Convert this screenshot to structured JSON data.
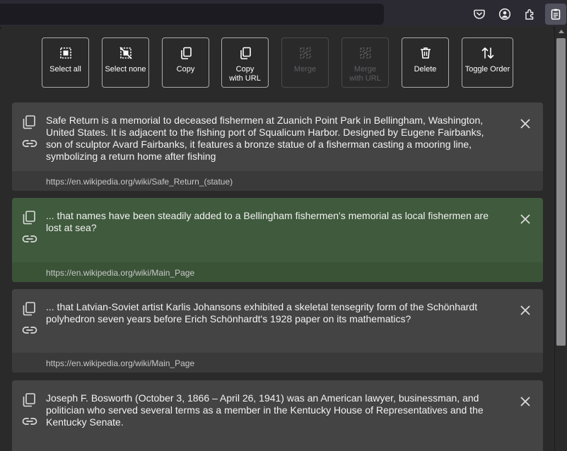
{
  "toolbar": {
    "select_all": "Select all",
    "select_none": "Select none",
    "copy": "Copy",
    "copy_with_url": "Copy\nwith URL",
    "merge": "Merge",
    "merge_with_url": "Merge\nwith URL",
    "delete": "Delete",
    "toggle_order": "Toggle Order"
  },
  "browser_icons": [
    "pocket-icon",
    "account-icon",
    "extensions-icon",
    "notes-sidebar-icon"
  ],
  "notes": [
    {
      "text": "Safe Return is a memorial to deceased fishermen at Zuanich Point Park in Bellingham, Washington, United States. It is adjacent to the fishing port of Squalicum Harbor. Designed by Eugene Fairbanks, son of sculptor Avard Fairbanks, it features a bronze statue of a fisherman casting a mooring line, symbolizing a return home after fishing",
      "url": "https://en.wikipedia.org/wiki/Safe_Return_(statue)",
      "selected": false
    },
    {
      "text": "... that names have been steadily added to a Bellingham fishermen's memorial as local fishermen are lost at sea?",
      "url": "https://en.wikipedia.org/wiki/Main_Page",
      "selected": true
    },
    {
      "text": "... that Latvian-Soviet artist Karlis Johansons exhibited a skeletal tensegrity form of the Schönhardt polyhedron seven years before Erich Schönhardt's 1928 paper on its mathematics?",
      "url": "https://en.wikipedia.org/wiki/Main_Page",
      "selected": false
    },
    {
      "text": "Joseph F. Bosworth (October 3, 1866 – April 26, 1941) was an American lawyer, businessman, and politician who served several terms as a member in the Kentucky House of Representatives and the Kentucky Senate.",
      "url": "",
      "selected": false
    }
  ],
  "colors": {
    "selected_card": "#3f5a3c",
    "card": "#444444",
    "panel": "#2b2a2b"
  }
}
